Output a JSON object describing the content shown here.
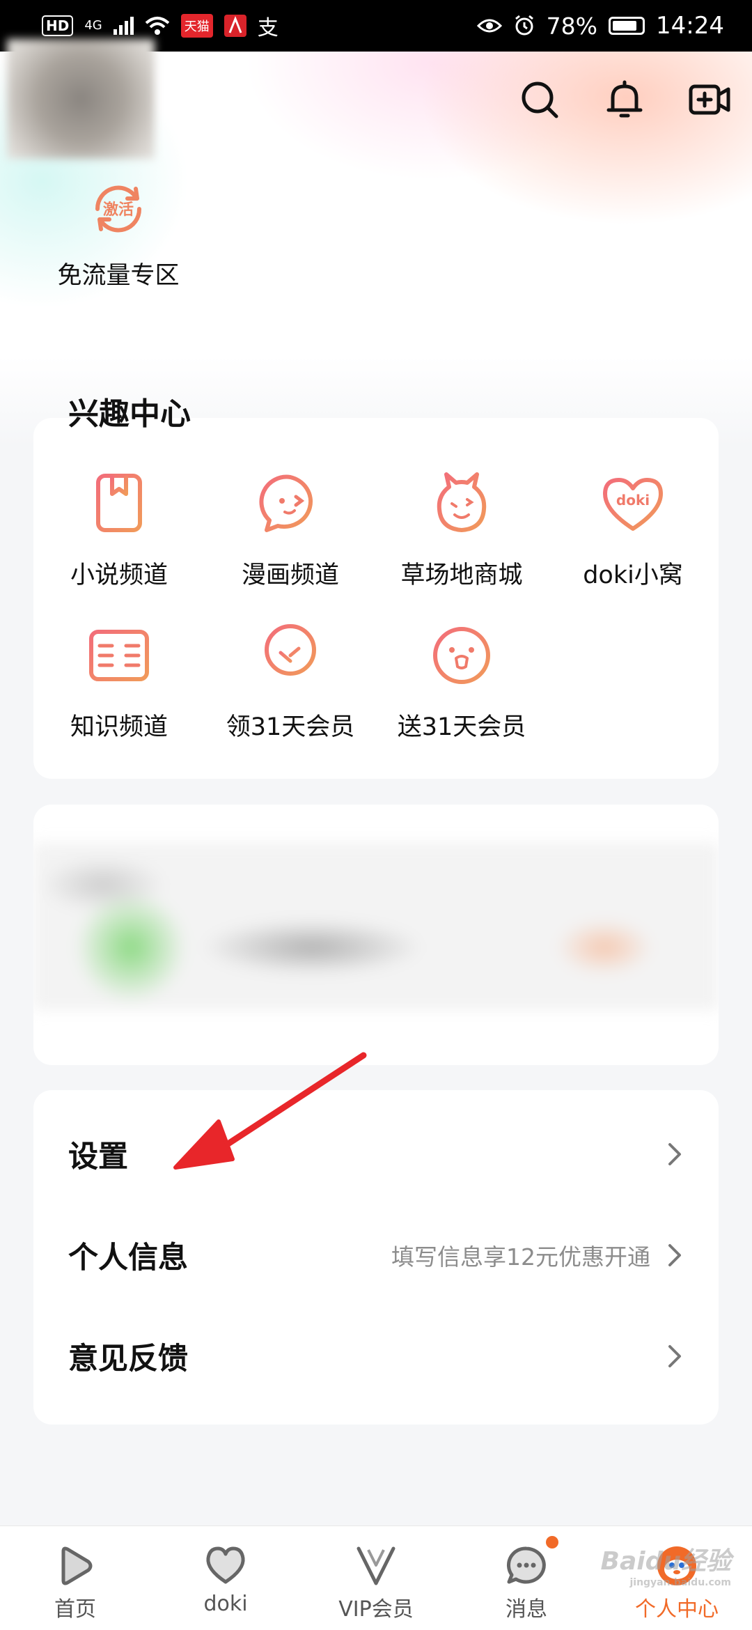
{
  "status_bar": {
    "network_hd": "HD",
    "network_type": "4G",
    "app_badge": "天猫",
    "pay_glyph": "支",
    "battery": "78%",
    "time": "14:24"
  },
  "header": {
    "icons": [
      "search-icon",
      "bell-icon",
      "video-add-icon"
    ]
  },
  "quick_entry": {
    "badge_text": "激活",
    "label": "免流量专区"
  },
  "interest_center": {
    "title": "兴趣中心",
    "items": [
      {
        "label": "小说频道",
        "icon": "book-icon"
      },
      {
        "label": "漫画频道",
        "icon": "comic-face-icon"
      },
      {
        "label": "草场地商城",
        "icon": "alpaca-icon"
      },
      {
        "label": "doki小窝",
        "icon": "doki-heart-icon",
        "icon_text": "doki"
      },
      {
        "label": "知识频道",
        "icon": "open-book-icon"
      },
      {
        "label": "领31天会员",
        "icon": "tree-icon"
      },
      {
        "label": "送31天会员",
        "icon": "face-icon"
      }
    ]
  },
  "menu": {
    "items": [
      {
        "label": "设置",
        "hint": ""
      },
      {
        "label": "个人信息",
        "hint": "填写信息享12元优惠开通"
      },
      {
        "label": "意见反馈",
        "hint": ""
      }
    ]
  },
  "tabbar": {
    "tabs": [
      {
        "label": "首页",
        "icon": "play-icon",
        "active": false
      },
      {
        "label": "doki",
        "icon": "heart-icon",
        "active": false
      },
      {
        "label": "VIP会员",
        "icon": "vip-v-icon",
        "active": false
      },
      {
        "label": "消息",
        "icon": "message-icon",
        "active": false
      },
      {
        "label": "个人中心",
        "icon": "profile-mascot-icon",
        "active": true
      }
    ]
  },
  "watermark": {
    "text": "Baidu经验",
    "sub": "jingyan.baidu.com"
  },
  "colors": {
    "accent": "#f16a28",
    "icon_orange": "#f08a6a",
    "arrow_red": "#e8262a"
  }
}
